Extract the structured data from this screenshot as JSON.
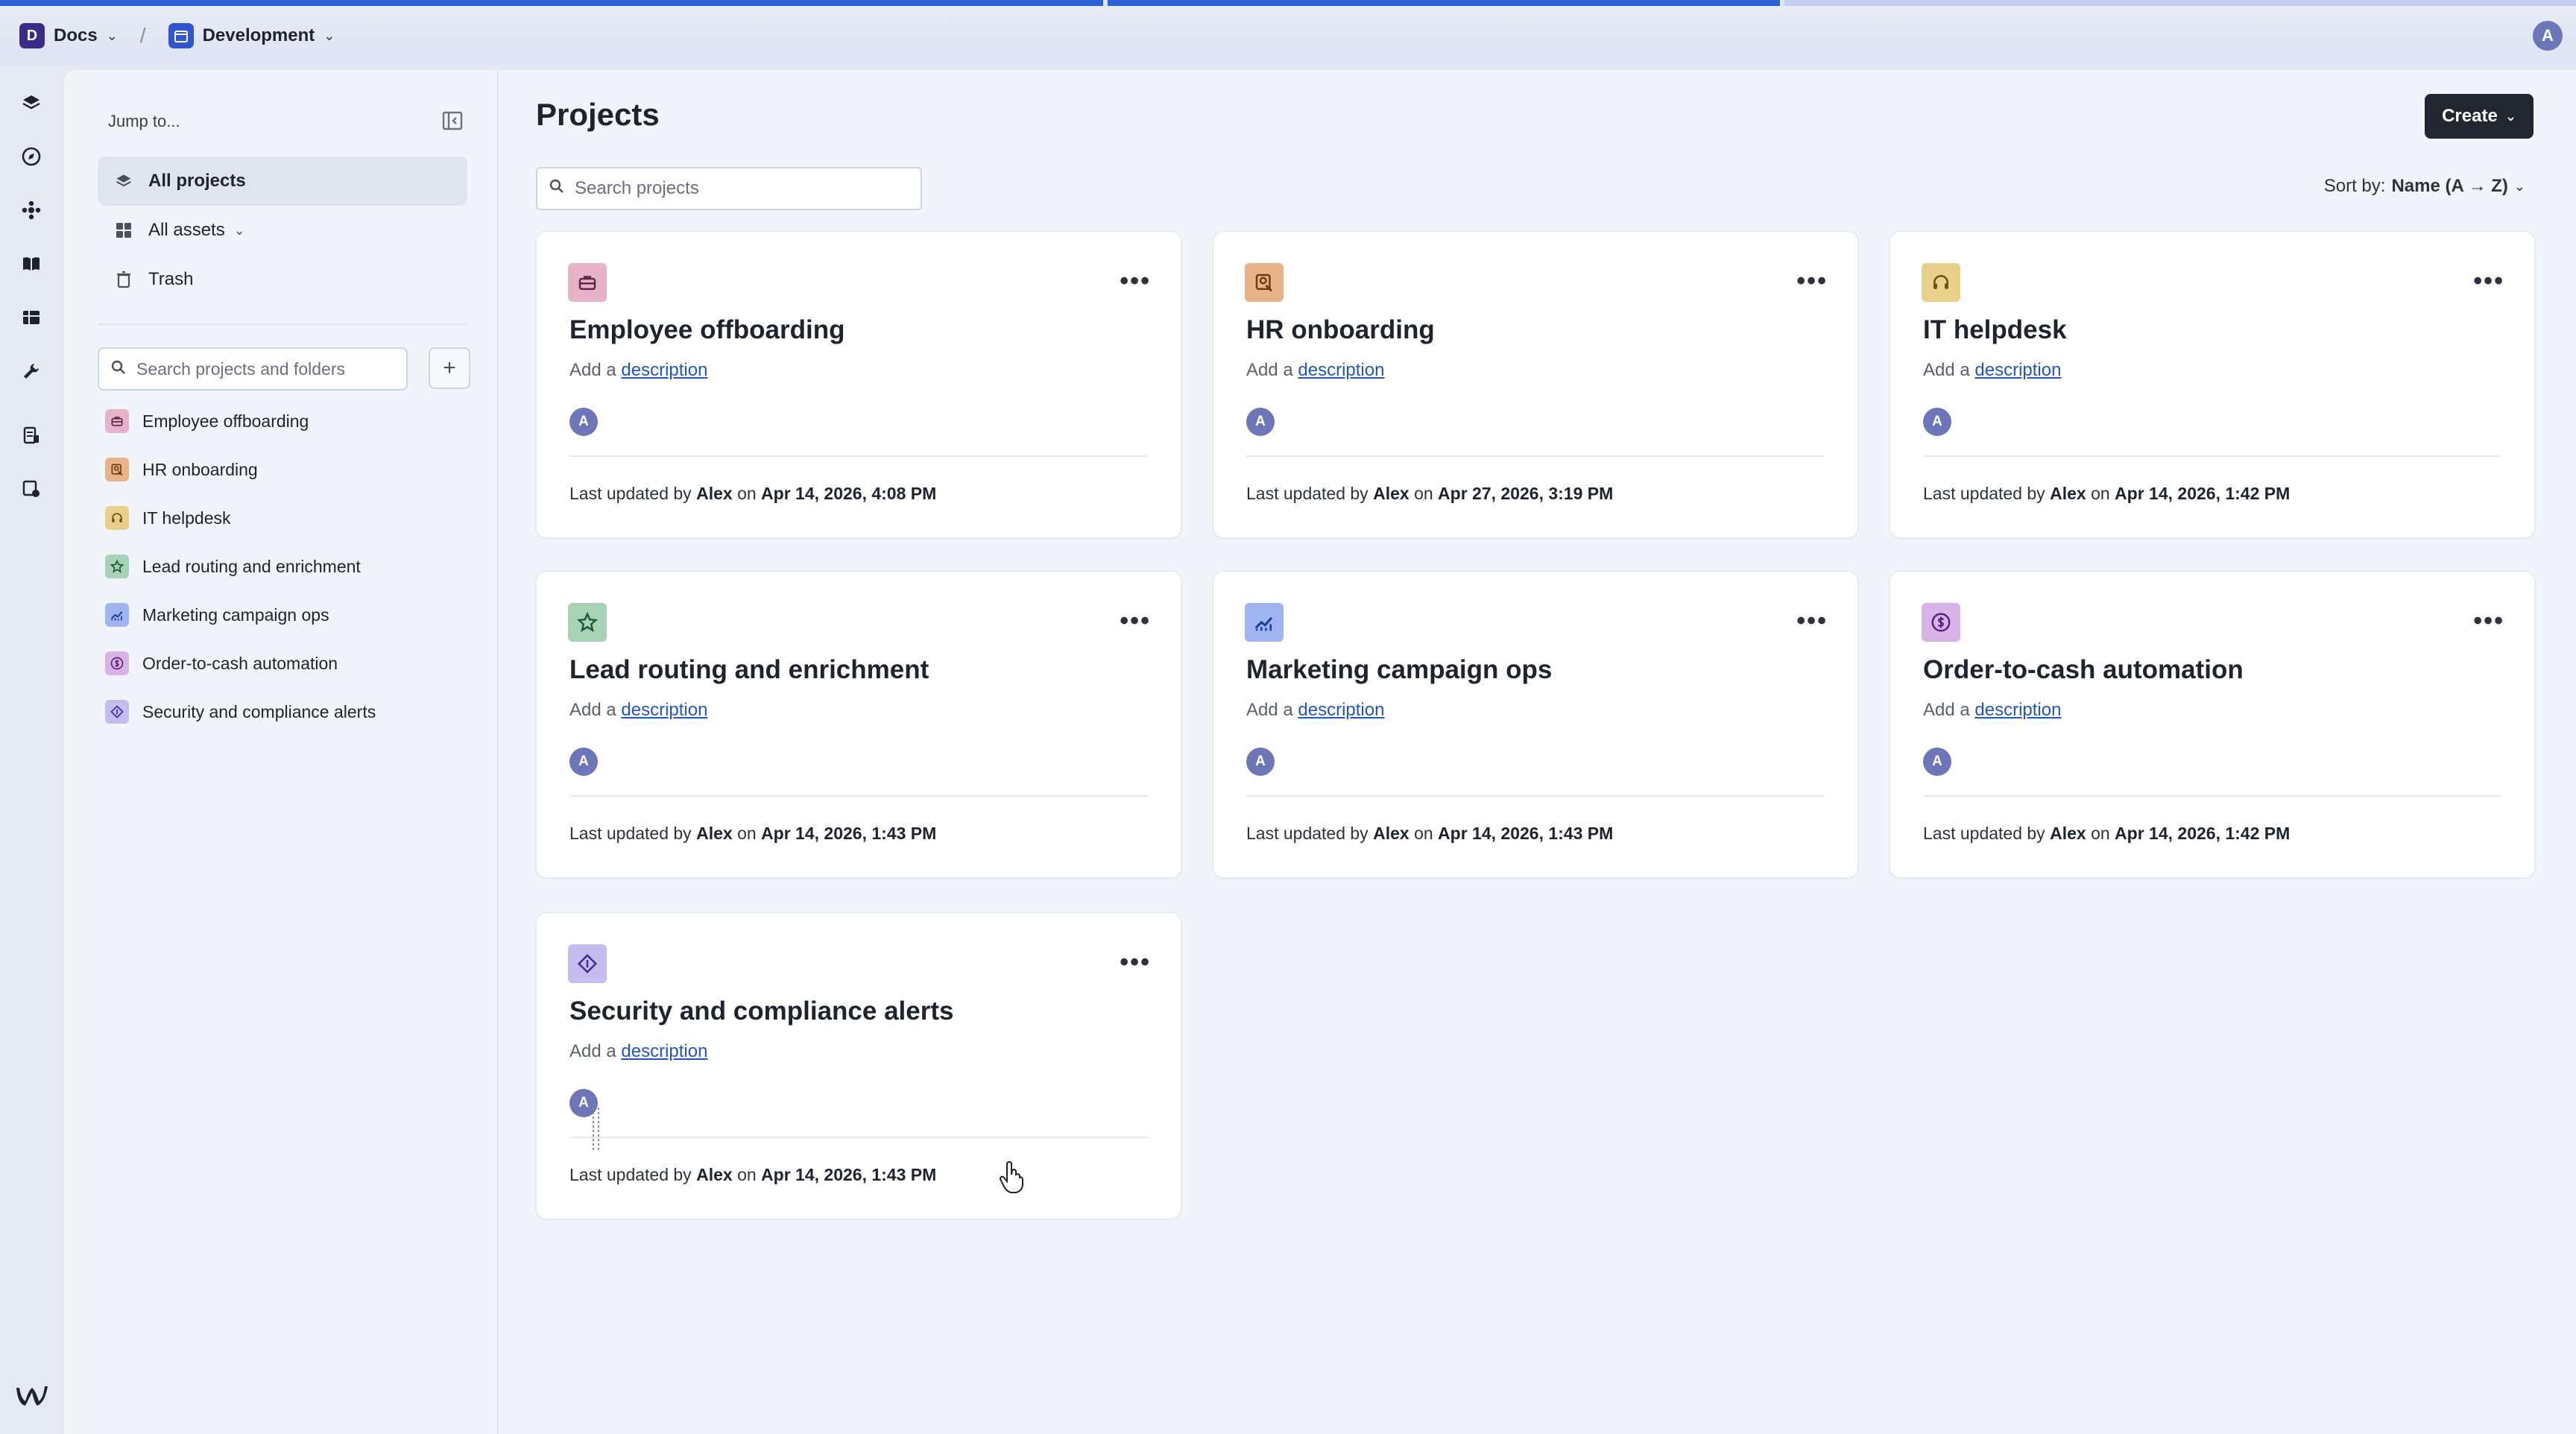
{
  "topbar": {
    "workspace_letter": "D",
    "workspace": "Docs",
    "environment": "Development",
    "user_initial": "A"
  },
  "sidebar": {
    "jump_to": "Jump to...",
    "nav": [
      {
        "label": "All projects"
      },
      {
        "label": "All assets"
      },
      {
        "label": "Trash"
      }
    ],
    "search_placeholder": "Search projects and folders",
    "add_label": "+",
    "tree": [
      {
        "label": "Employee offboarding",
        "color": "#e7b3c8",
        "icon": "briefcase-icon"
      },
      {
        "label": "HR onboarding",
        "color": "#e9b389",
        "icon": "person-search-icon"
      },
      {
        "label": "IT helpdesk",
        "color": "#e9d089",
        "icon": "headset-icon"
      },
      {
        "label": "Lead routing and enrichment",
        "color": "#a8d2b6",
        "icon": "star-icon"
      },
      {
        "label": "Marketing campaign ops",
        "color": "#9fb4f0",
        "icon": "chart-icon"
      },
      {
        "label": "Order-to-cash automation",
        "color": "#d8b3e8",
        "icon": "dollar-icon"
      },
      {
        "label": "Security and compliance alerts",
        "color": "#c7bcf0",
        "icon": "diamond-icon"
      }
    ]
  },
  "main": {
    "title": "Projects",
    "create_label": "Create",
    "search_placeholder": "Search projects",
    "sort_prefix": "Sort by:",
    "sort_value": "Name (A → Z)"
  },
  "cards": [
    {
      "title": "Employee offboarding",
      "desc_prefix": "Add a",
      "desc_link": "description",
      "avatar": "A",
      "foot_prefix": "Last updated by",
      "user": "Alex",
      "on": "on",
      "date": "Apr 14, 2026, 4:08 PM"
    },
    {
      "title": "HR onboarding",
      "desc_prefix": "Add a",
      "desc_link": "description",
      "avatar": "A",
      "foot_prefix": "Last updated by",
      "user": "Alex",
      "on": "on",
      "date": "Apr 27, 2026, 3:19 PM"
    },
    {
      "title": "IT helpdesk",
      "desc_prefix": "Add a",
      "desc_link": "description",
      "avatar": "A",
      "foot_prefix": "Last updated by",
      "user": "Alex",
      "on": "on",
      "date": "Apr 14, 2026, 1:42 PM"
    },
    {
      "title": "Lead routing and enrichment",
      "desc_prefix": "Add a",
      "desc_link": "description",
      "avatar": "A",
      "foot_prefix": "Last updated by",
      "user": "Alex",
      "on": "on",
      "date": "Apr 14, 2026, 1:43 PM"
    },
    {
      "title": "Marketing campaign ops",
      "desc_prefix": "Add a",
      "desc_link": "description",
      "avatar": "A",
      "foot_prefix": "Last updated by",
      "user": "Alex",
      "on": "on",
      "date": "Apr 14, 2026, 1:43 PM"
    },
    {
      "title": "Order-to-cash automation",
      "desc_prefix": "Add a",
      "desc_link": "description",
      "avatar": "A",
      "foot_prefix": "Last updated by",
      "user": "Alex",
      "on": "on",
      "date": "Apr 14, 2026, 1:42 PM"
    },
    {
      "title": "Security and compliance alerts",
      "desc_prefix": "Add a",
      "desc_link": "description",
      "avatar": "A",
      "foot_prefix": "Last updated by",
      "user": "Alex",
      "on": "on",
      "date": "Apr 14, 2026, 1:43 PM"
    }
  ],
  "colors": {
    "accent": "#2c5fd8",
    "link": "#2255c4",
    "avatar": "#6c76b8",
    "button_dark": "#222630"
  }
}
